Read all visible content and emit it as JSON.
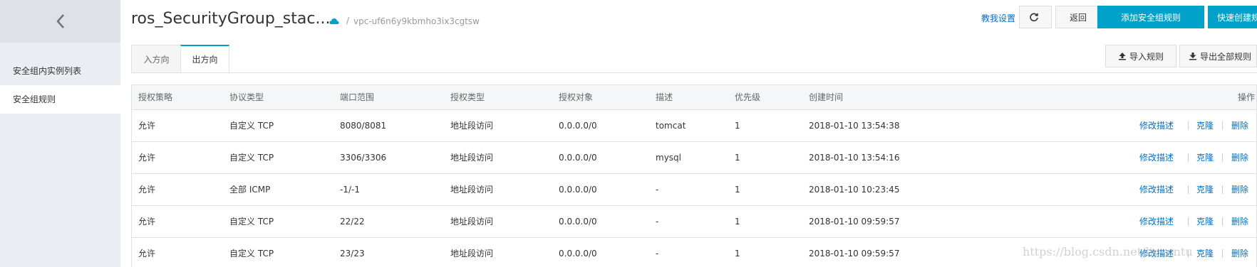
{
  "sidebar": {
    "back_icon": "chevron-left-icon",
    "items": [
      {
        "label": "安全组内实例列表",
        "active": false
      },
      {
        "label": "安全组规则",
        "active": true
      }
    ]
  },
  "header": {
    "title": "ros_SecurityGroup_stac...",
    "cloud_icon": "cloud-icon",
    "separator": "/",
    "vpc_id": "vpc-uf6n6y9kbmho3ix3cgtsw",
    "help_link": "教我设置",
    "refresh_icon": "refresh-icon",
    "back_label": "返回",
    "add_rule_label": "添加安全组规则",
    "quick_create_label": "快速创建规则"
  },
  "tabs": [
    {
      "label": "入方向",
      "active": false
    },
    {
      "label": "出方向",
      "active": true
    }
  ],
  "actions": {
    "import_label": "导入规则",
    "export_label": "导出全部规则"
  },
  "table": {
    "columns": [
      "授权策略",
      "协议类型",
      "端口范围",
      "授权类型",
      "授权对象",
      "描述",
      "优先级",
      "创建时间",
      "操作"
    ],
    "rows": [
      {
        "policy": "允许",
        "protocol": "自定义 TCP",
        "port": "8080/8081",
        "auth_type": "地址段访问",
        "target": "0.0.0.0/0",
        "desc": "tomcat",
        "priority": "1",
        "created": "2018-01-10 13:54:38"
      },
      {
        "policy": "允许",
        "protocol": "自定义 TCP",
        "port": "3306/3306",
        "auth_type": "地址段访问",
        "target": "0.0.0.0/0",
        "desc": "mysql",
        "priority": "1",
        "created": "2018-01-10 13:54:16"
      },
      {
        "policy": "允许",
        "protocol": "全部 ICMP",
        "port": "-1/-1",
        "auth_type": "地址段访问",
        "target": "0.0.0.0/0",
        "desc": "-",
        "priority": "1",
        "created": "2018-01-10 10:23:45"
      },
      {
        "policy": "允许",
        "protocol": "自定义 TCP",
        "port": "22/22",
        "auth_type": "地址段访问",
        "target": "0.0.0.0/0",
        "desc": "-",
        "priority": "1",
        "created": "2018-01-10 09:59:57"
      },
      {
        "policy": "允许",
        "protocol": "自定义 TCP",
        "port": "23/23",
        "auth_type": "地址段访问",
        "target": "0.0.0.0/0",
        "desc": "-",
        "priority": "1",
        "created": "2018-01-10 09:59:57"
      }
    ],
    "ops": [
      "修改描述",
      "克隆",
      "删除"
    ]
  },
  "watermark": "https://blog.csdn.net/liyuantu",
  "colors": {
    "accent": "#00a2ca",
    "link": "#0070cc",
    "sidebar_bg": "#eaedf1"
  }
}
